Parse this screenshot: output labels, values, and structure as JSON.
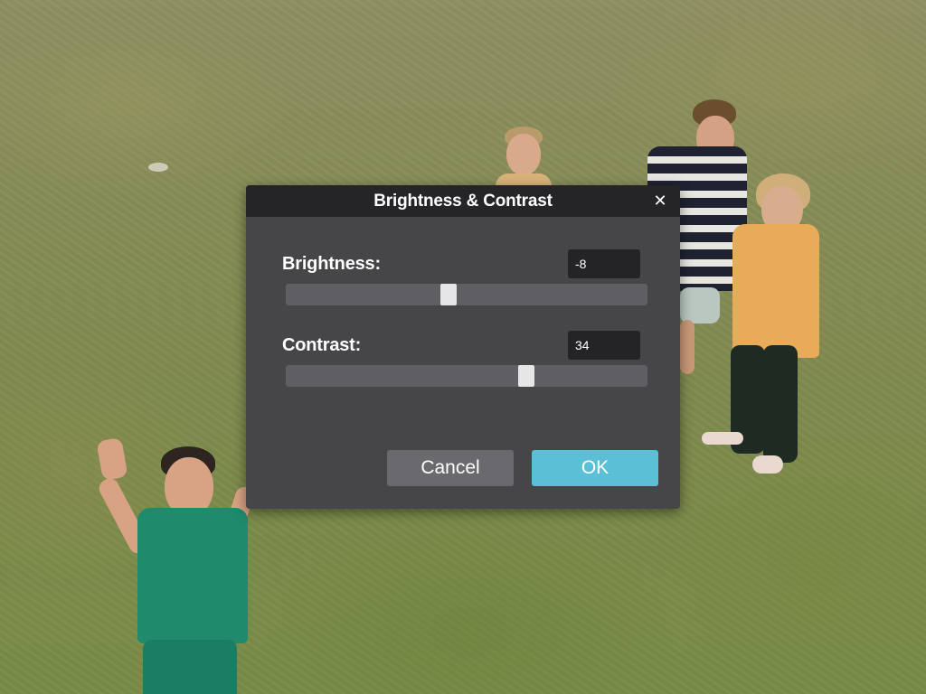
{
  "dialog": {
    "title": "Brightness & Contrast",
    "close_icon": "close-icon",
    "brightness": {
      "label": "Brightness:",
      "value": "-8",
      "slider_level": 0.45
    },
    "contrast": {
      "label": "Contrast:",
      "value": "34",
      "slider_level": 0.665
    },
    "buttons": {
      "cancel": "Cancel",
      "ok": "OK"
    }
  },
  "colors": {
    "accent": "#5bbfd6",
    "dialog_bg": "#464649",
    "titlebar_bg": "#252527"
  }
}
